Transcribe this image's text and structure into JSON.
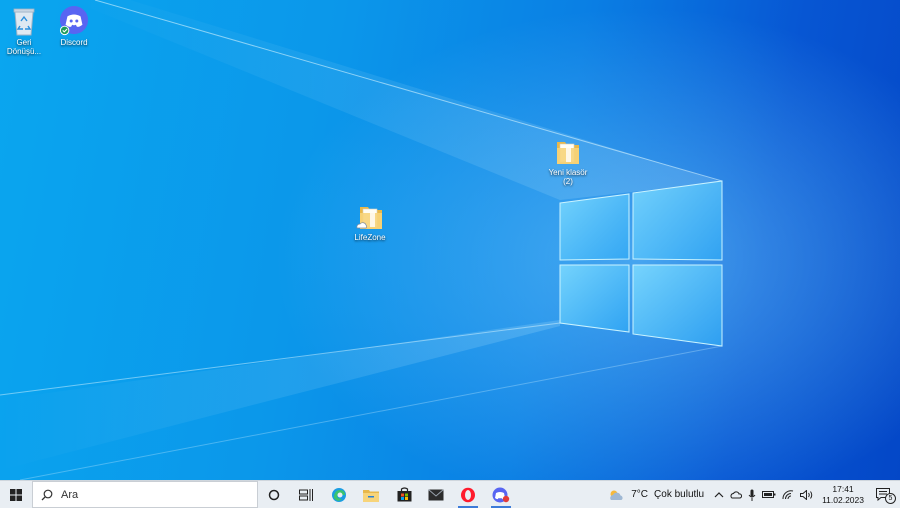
{
  "desktop": {
    "icons": [
      {
        "label_line1": "Geri",
        "label_line2": "Dönüşü..."
      },
      {
        "label_line1": "Discord",
        "label_line2": ""
      },
      {
        "label_line1": "Yeni klasör",
        "label_line2": "(2)"
      },
      {
        "label_line1": "LifeZone",
        "label_line2": ""
      }
    ]
  },
  "taskbar": {
    "search_placeholder": "Ara",
    "apps": [
      "cortana-icon",
      "task-view-icon",
      "edge-icon",
      "file-explorer-icon",
      "store-icon",
      "mail-icon",
      "opera-icon",
      "discord-icon"
    ],
    "weather": {
      "temp": "7°C",
      "desc": "Çok bulutlu"
    },
    "clock": {
      "time": "17:41",
      "date": "11.02.2023"
    },
    "notification_count": "5"
  },
  "colors": {
    "accent": "#3d7bd8",
    "desktop_blue": "#0a7fe4",
    "taskbar": "#e9eef3"
  }
}
